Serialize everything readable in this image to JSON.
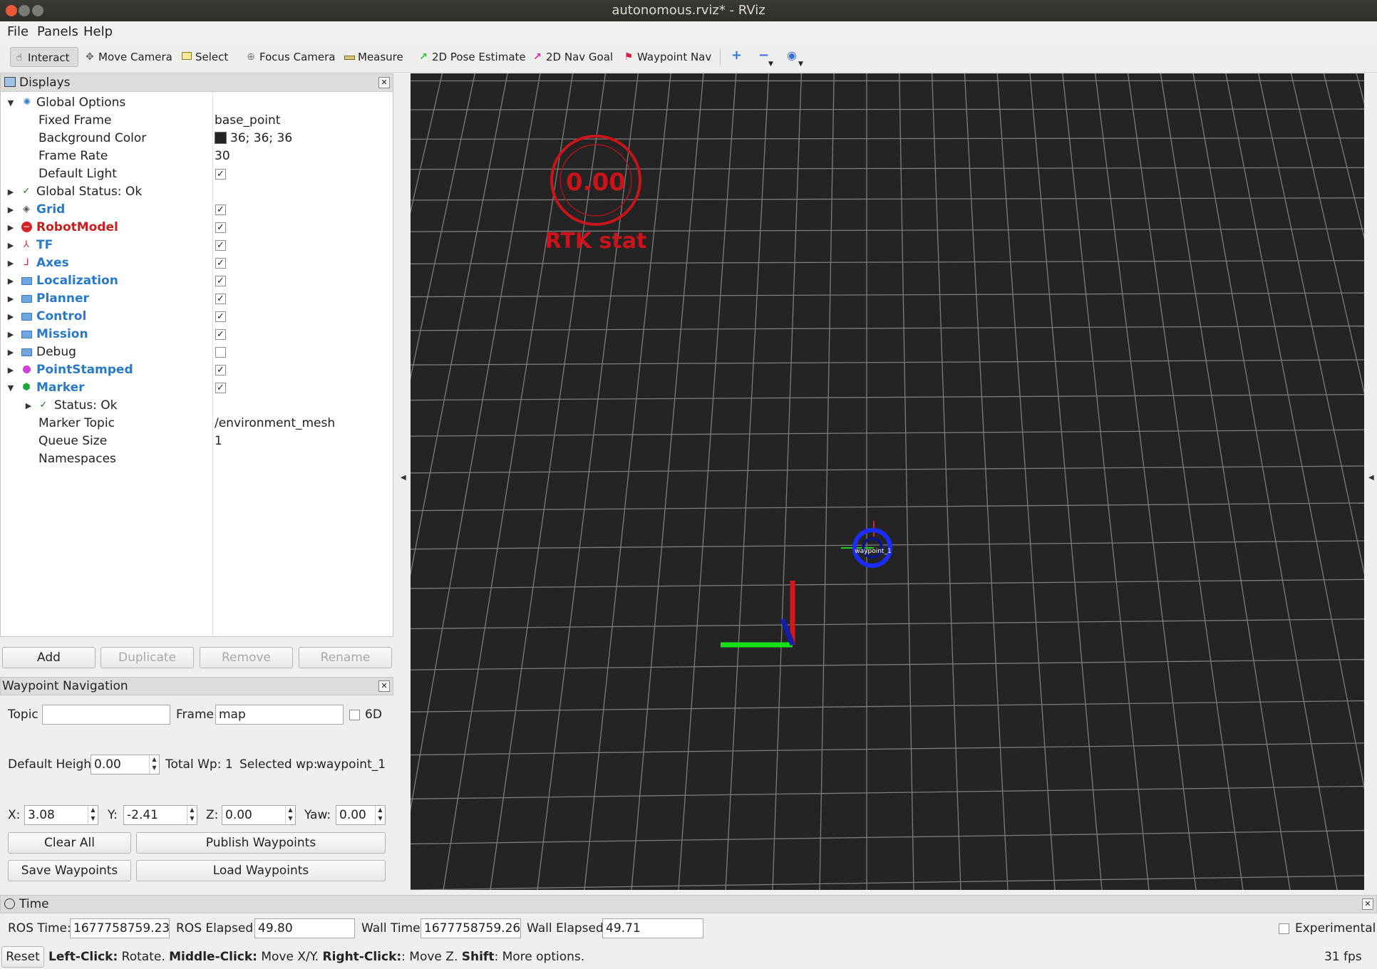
{
  "window": {
    "title": "autonomous.rviz* - RViz"
  },
  "menu": [
    {
      "label": "File"
    },
    {
      "label": "Panels"
    },
    {
      "label": "Help"
    }
  ],
  "toolbar": {
    "tools": [
      {
        "label": "Interact",
        "icon": "hand-icon"
      },
      {
        "label": "Move Camera",
        "icon": "move-icon"
      },
      {
        "label": "Select",
        "icon": "select-icon"
      },
      {
        "label": "Focus Camera",
        "icon": "focus-icon"
      },
      {
        "label": "Measure",
        "icon": "ruler-icon"
      },
      {
        "label": "2D Pose Estimate",
        "icon": "green-arrow-icon"
      },
      {
        "label": "2D Nav Goal",
        "icon": "pink-arrow-icon"
      },
      {
        "label": "Waypoint Nav",
        "icon": "flag-icon"
      }
    ],
    "active": "Interact"
  },
  "displays": {
    "title": "Displays",
    "rows": [
      {
        "label": "Global Options"
      },
      {
        "label": "Fixed Frame",
        "value": "base_point"
      },
      {
        "label": "Background Color",
        "value": "36; 36; 36"
      },
      {
        "label": "Frame Rate",
        "value": "30"
      },
      {
        "label": "Default Light"
      },
      {
        "label": "Global Status: Ok"
      },
      {
        "label": "Grid"
      },
      {
        "label": "RobotModel"
      },
      {
        "label": "TF"
      },
      {
        "label": "Axes"
      },
      {
        "label": "Localization"
      },
      {
        "label": "Planner"
      },
      {
        "label": "Control"
      },
      {
        "label": "Mission"
      },
      {
        "label": "Debug"
      },
      {
        "label": "PointStamped"
      },
      {
        "label": "Marker"
      },
      {
        "label": "Status: Ok"
      },
      {
        "label": "Marker Topic",
        "value": "/environment_mesh"
      },
      {
        "label": "Queue Size",
        "value": "1"
      },
      {
        "label": "Namespaces"
      }
    ],
    "buttons": {
      "add": "Add",
      "duplicate": "Duplicate",
      "remove": "Remove",
      "rename": "Rename"
    }
  },
  "waypoint": {
    "title": "Waypoint Navigation",
    "topic_label": "Topic",
    "topic_value": "",
    "frame_label": "Frame",
    "frame_value": "map",
    "sixd_label": "6D",
    "height_label": "Default Height",
    "height_value": "0.00",
    "total_label": "Total Wp: 1",
    "selected_label": "Selected wp:",
    "selected_value": "waypoint_1",
    "x_label": "X:",
    "x_value": "3.08",
    "y_label": "Y:",
    "y_value": "-2.41",
    "z_label": "Z:",
    "z_value": "0.00",
    "yaw_label": "Yaw:",
    "yaw_value": "0.00",
    "clear": "Clear All",
    "publish": "Publish Waypoints",
    "save": "Save Waypoints",
    "load": "Load Waypoints"
  },
  "viewport": {
    "rtk_value": "0.00",
    "rtk_label": "RTK stat",
    "waypoint_label": "waypoint_1",
    "colors": {
      "background": "#242424",
      "grid": "#a0a0a0",
      "rtk": "#c8141a",
      "waypoint": "#1a2cff"
    }
  },
  "time": {
    "title": "Time",
    "ros_time_label": "ROS Time:",
    "ros_time": "1677758759.23",
    "ros_elapsed_label": "ROS Elapsed:",
    "ros_elapsed": "49.80",
    "wall_time_label": "Wall Time:",
    "wall_time": "1677758759.26",
    "wall_elapsed_label": "Wall Elapsed:",
    "wall_elapsed": "49.71",
    "experimental": "Experimental"
  },
  "status": {
    "reset": "Reset",
    "help": [
      {
        "k": "Left-Click:",
        "v": " Rotate. "
      },
      {
        "k": "Middle-Click:",
        "v": " Move X/Y. "
      },
      {
        "k": "Right-Click:",
        "v": ": Move Z. "
      },
      {
        "k": "Shift",
        "v": ": More options."
      }
    ],
    "fps": "31 fps"
  }
}
